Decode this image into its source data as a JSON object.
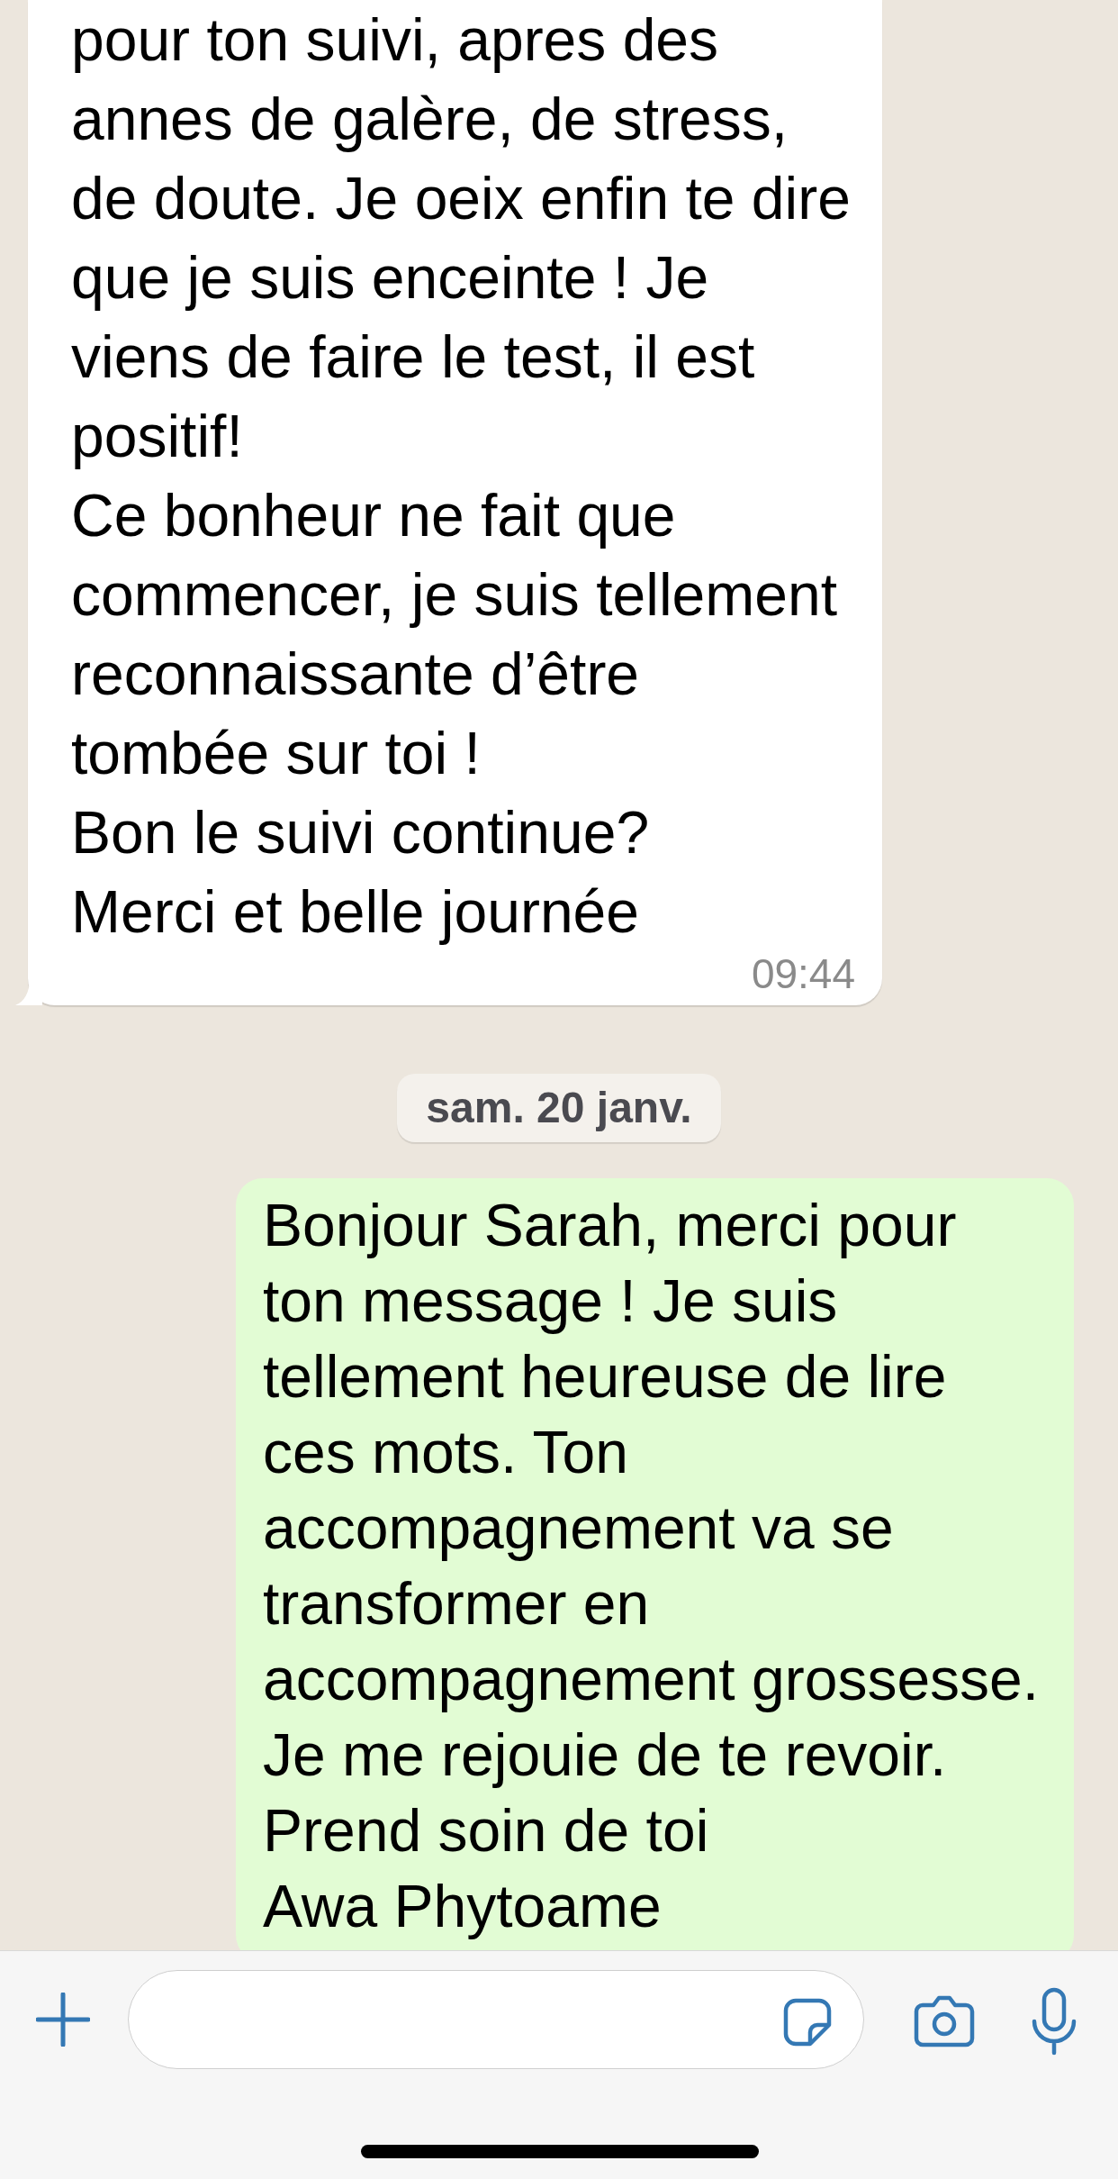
{
  "messages": [
    {
      "kind": "incoming",
      "text": "pour ton suivi, apres des\nannes de galère, de stress,\nde doute. Je oeix enfin te dire\nque je suis enceinte ! Je\nviens de faire le test, il est\npositif!\nCe bonheur ne fait que\ncommencer, je suis tellement\nreconnaissante d’être\ntombée sur toi !\nBon le suivi continue?\nMerci et belle journée",
      "time": "09:44"
    },
    {
      "kind": "date",
      "text": "sam. 20 janv."
    },
    {
      "kind": "outgoing",
      "text": "Bonjour Sarah, merci pour\nton message ! Je suis\ntellement heureuse de lire\nces mots. Ton\naccompagnement va se\ntransformer en\naccompagnement grossesse.\nJe me rejouie de te revoir.\nPrend soin de toi\nAwa Phytoame"
    }
  ]
}
